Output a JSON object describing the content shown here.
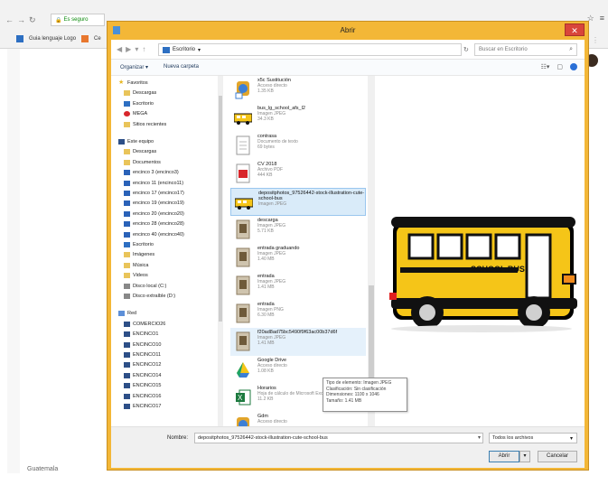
{
  "browser": {
    "security_label": "Es seguro",
    "bookmarks": [
      "Guia lenguaje Logo",
      "Ce"
    ],
    "footer_text": "Guatemala"
  },
  "dialog": {
    "title": "Abrir",
    "close_glyph": "✕",
    "address_path": "Escritorio",
    "search_placeholder": "Buscar en Escritorio",
    "organize_label": "Organizar ▾",
    "new_folder_label": "Nueva carpeta",
    "nav_items": [
      {
        "label": "Favoritos",
        "icon": "star-icon"
      },
      {
        "label": "Descargas",
        "icon": "folder-icon"
      },
      {
        "label": "Escritorio",
        "icon": "desktop-icon"
      },
      {
        "label": "MEGA",
        "icon": "mega-icon"
      },
      {
        "label": "Sitios recientes",
        "icon": "folder-icon"
      },
      {
        "label": "Este equipo",
        "icon": "computer-icon"
      },
      {
        "label": "Descargas",
        "icon": "folder-icon"
      },
      {
        "label": "Documentos",
        "icon": "folder-icon"
      },
      {
        "label": "encinco 3 (encinco3)",
        "icon": "network-drive-icon"
      },
      {
        "label": "encinco 11 (encinco11)",
        "icon": "network-drive-icon"
      },
      {
        "label": "encinco 17 (encinco17)",
        "icon": "network-drive-icon"
      },
      {
        "label": "encinco 19 (encinco19)",
        "icon": "network-drive-icon"
      },
      {
        "label": "encinco 20 (encinco20)",
        "icon": "network-drive-icon"
      },
      {
        "label": "encinco 28 (encinco28)",
        "icon": "network-drive-icon"
      },
      {
        "label": "encinco 40 (encinco40)",
        "icon": "network-drive-icon"
      },
      {
        "label": "Escritorio",
        "icon": "desktop-icon"
      },
      {
        "label": "Imágenes",
        "icon": "folder-icon"
      },
      {
        "label": "Música",
        "icon": "folder-icon"
      },
      {
        "label": "Videos",
        "icon": "folder-icon"
      },
      {
        "label": "Disco local (C:)",
        "icon": "drive-icon"
      },
      {
        "label": "Disco extraíble (D:)",
        "icon": "drive-icon"
      },
      {
        "label": "Red",
        "icon": "network-icon"
      },
      {
        "label": "COMERCIO26",
        "icon": "computer-icon"
      },
      {
        "label": "ENCINCO1",
        "icon": "computer-icon"
      },
      {
        "label": "ENCINCO10",
        "icon": "computer-icon"
      },
      {
        "label": "ENCINCO11",
        "icon": "computer-icon"
      },
      {
        "label": "ENCINCO12",
        "icon": "computer-icon"
      },
      {
        "label": "ENCINCO14",
        "icon": "computer-icon"
      },
      {
        "label": "ENCINCO15",
        "icon": "computer-icon"
      },
      {
        "label": "ENCINCO16",
        "icon": "computer-icon"
      },
      {
        "label": "ENCINCO17",
        "icon": "computer-icon"
      }
    ],
    "files": [
      {
        "name": "x5c Sustitución",
        "type": "Acceso directo",
        "size": "1.35 KB",
        "icon": "shortcut-icon",
        "state": ""
      },
      {
        "name": "bus_lg_school_afs_l2",
        "type": "Imagen JPEG",
        "size": "34.3 KB",
        "icon": "bus-image-icon",
        "state": ""
      },
      {
        "name": "contrasa",
        "type": "Documento de texto",
        "size": "69 bytes",
        "icon": "text-document-icon",
        "state": ""
      },
      {
        "name": "CV 2018",
        "type": "Archivo PDF",
        "size": "444 KB",
        "icon": "pdf-icon",
        "state": ""
      },
      {
        "name": "depositphotos_97526442-stock-illustration-cute-school-bus",
        "type": "Imagen JPEG",
        "size": "",
        "icon": "bus-image-icon",
        "state": "selected"
      },
      {
        "name": "descarga",
        "type": "Imagen JPEG",
        "size": "5.71 KB",
        "icon": "photo-icon",
        "state": ""
      },
      {
        "name": "entrada graduando",
        "type": "Imagen JPEG",
        "size": "1.40 MB",
        "icon": "photo-icon",
        "state": ""
      },
      {
        "name": "entrada",
        "type": "Imagen JPEG",
        "size": "1.41 MB",
        "icon": "photo-icon",
        "state": ""
      },
      {
        "name": "entrada",
        "type": "Imagen PNG",
        "size": "6.30 MB",
        "icon": "photo-icon",
        "state": ""
      },
      {
        "name": "f20ad8ad75bc5490f9f63ac00b37d6f",
        "type": "Imagen JPEG",
        "size": "1.41 MB",
        "icon": "photo-icon",
        "state": "hover"
      },
      {
        "name": "Google Drive",
        "type": "Acceso directo",
        "size": "1.08 KB",
        "icon": "google-drive-icon",
        "state": ""
      },
      {
        "name": "Horarios",
        "type": "Hoja de cálculo de Microsoft Excel",
        "size": "11.2 KB",
        "icon": "excel-icon",
        "state": ""
      },
      {
        "name": "Gdm",
        "type": "Acceso directo",
        "size": "",
        "icon": "shortcut-icon",
        "state": ""
      }
    ],
    "tooltip_lines": [
      "Tipo de elemento: Imagen JPEG",
      "Clasificación: Sin clasificación",
      "Dimensiones: 1100 x 1046",
      "Tamaño: 1.41 MB"
    ],
    "preview_text": "SCHOOL BUS",
    "file_name_label": "Nombre:",
    "file_name_value": "depositphotos_97526442-stock-illustration-cute-school-bus",
    "file_type_value": "Todos los archivos",
    "open_label": "Abrir",
    "cancel_label": "Cancelar"
  }
}
